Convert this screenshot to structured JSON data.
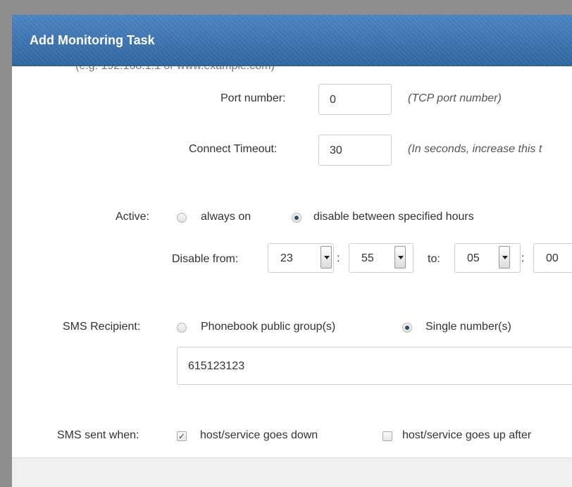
{
  "dialog": {
    "title": "Add Monitoring Task",
    "truncated_line": "(e.g. 192.168.1.1 or www.example.com)"
  },
  "port": {
    "label": "Port number:",
    "value": "0",
    "hint": "(TCP port number)"
  },
  "timeout": {
    "label": "Connect Timeout:",
    "value": "30",
    "hint": "(In seconds, increase this t"
  },
  "active": {
    "label": "Active:",
    "options": [
      "always on",
      "disable between specified hours"
    ],
    "selected": "disable between specified hours"
  },
  "disable": {
    "from_label": "Disable from:",
    "from_hour": "23",
    "from_minute": "55",
    "separator": ":",
    "to_label": "to:",
    "to_hour": "05",
    "to_minute": "00"
  },
  "sms_recipient": {
    "label": "SMS Recipient:",
    "options": [
      "Phonebook public group(s)",
      "Single number(s)"
    ],
    "selected": "Single number(s)",
    "number_value": "615123123"
  },
  "sms_sent_when": {
    "label": "SMS sent when:",
    "options": [
      {
        "label": "host/service goes down",
        "checked": true
      },
      {
        "label": "host/service goes up after",
        "checked": false
      }
    ]
  },
  "icons": {
    "check": "✓"
  }
}
